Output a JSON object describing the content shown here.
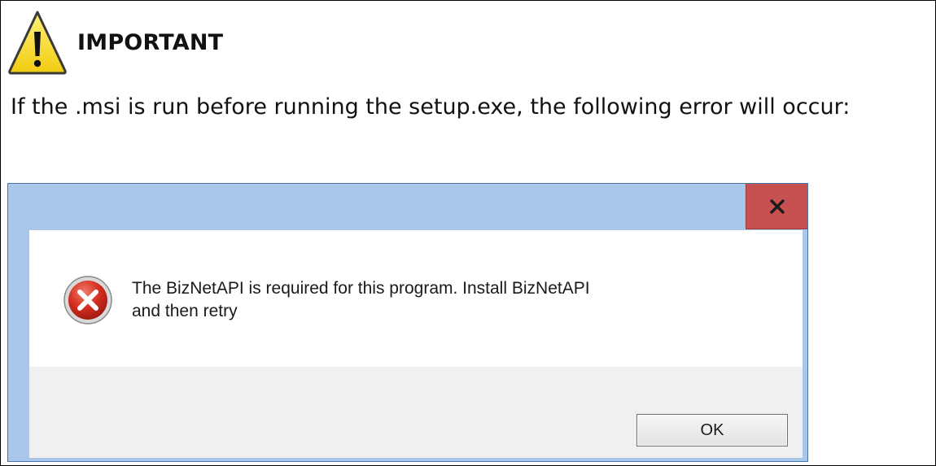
{
  "note": {
    "icon": "warning-icon",
    "title": "IMPORTANT",
    "text": "If the .msi is run before running the setup.exe, the following error will occur:"
  },
  "dialog": {
    "title_bar_color": "#a9c7ea",
    "close_button": {
      "icon": "close-icon",
      "label": "x",
      "color": "#c75050"
    },
    "error_icon": "error-icon",
    "message": "The BizNetAPI is required for this program.  Install BizNetAPI and then retry",
    "ok_label": "OK"
  }
}
